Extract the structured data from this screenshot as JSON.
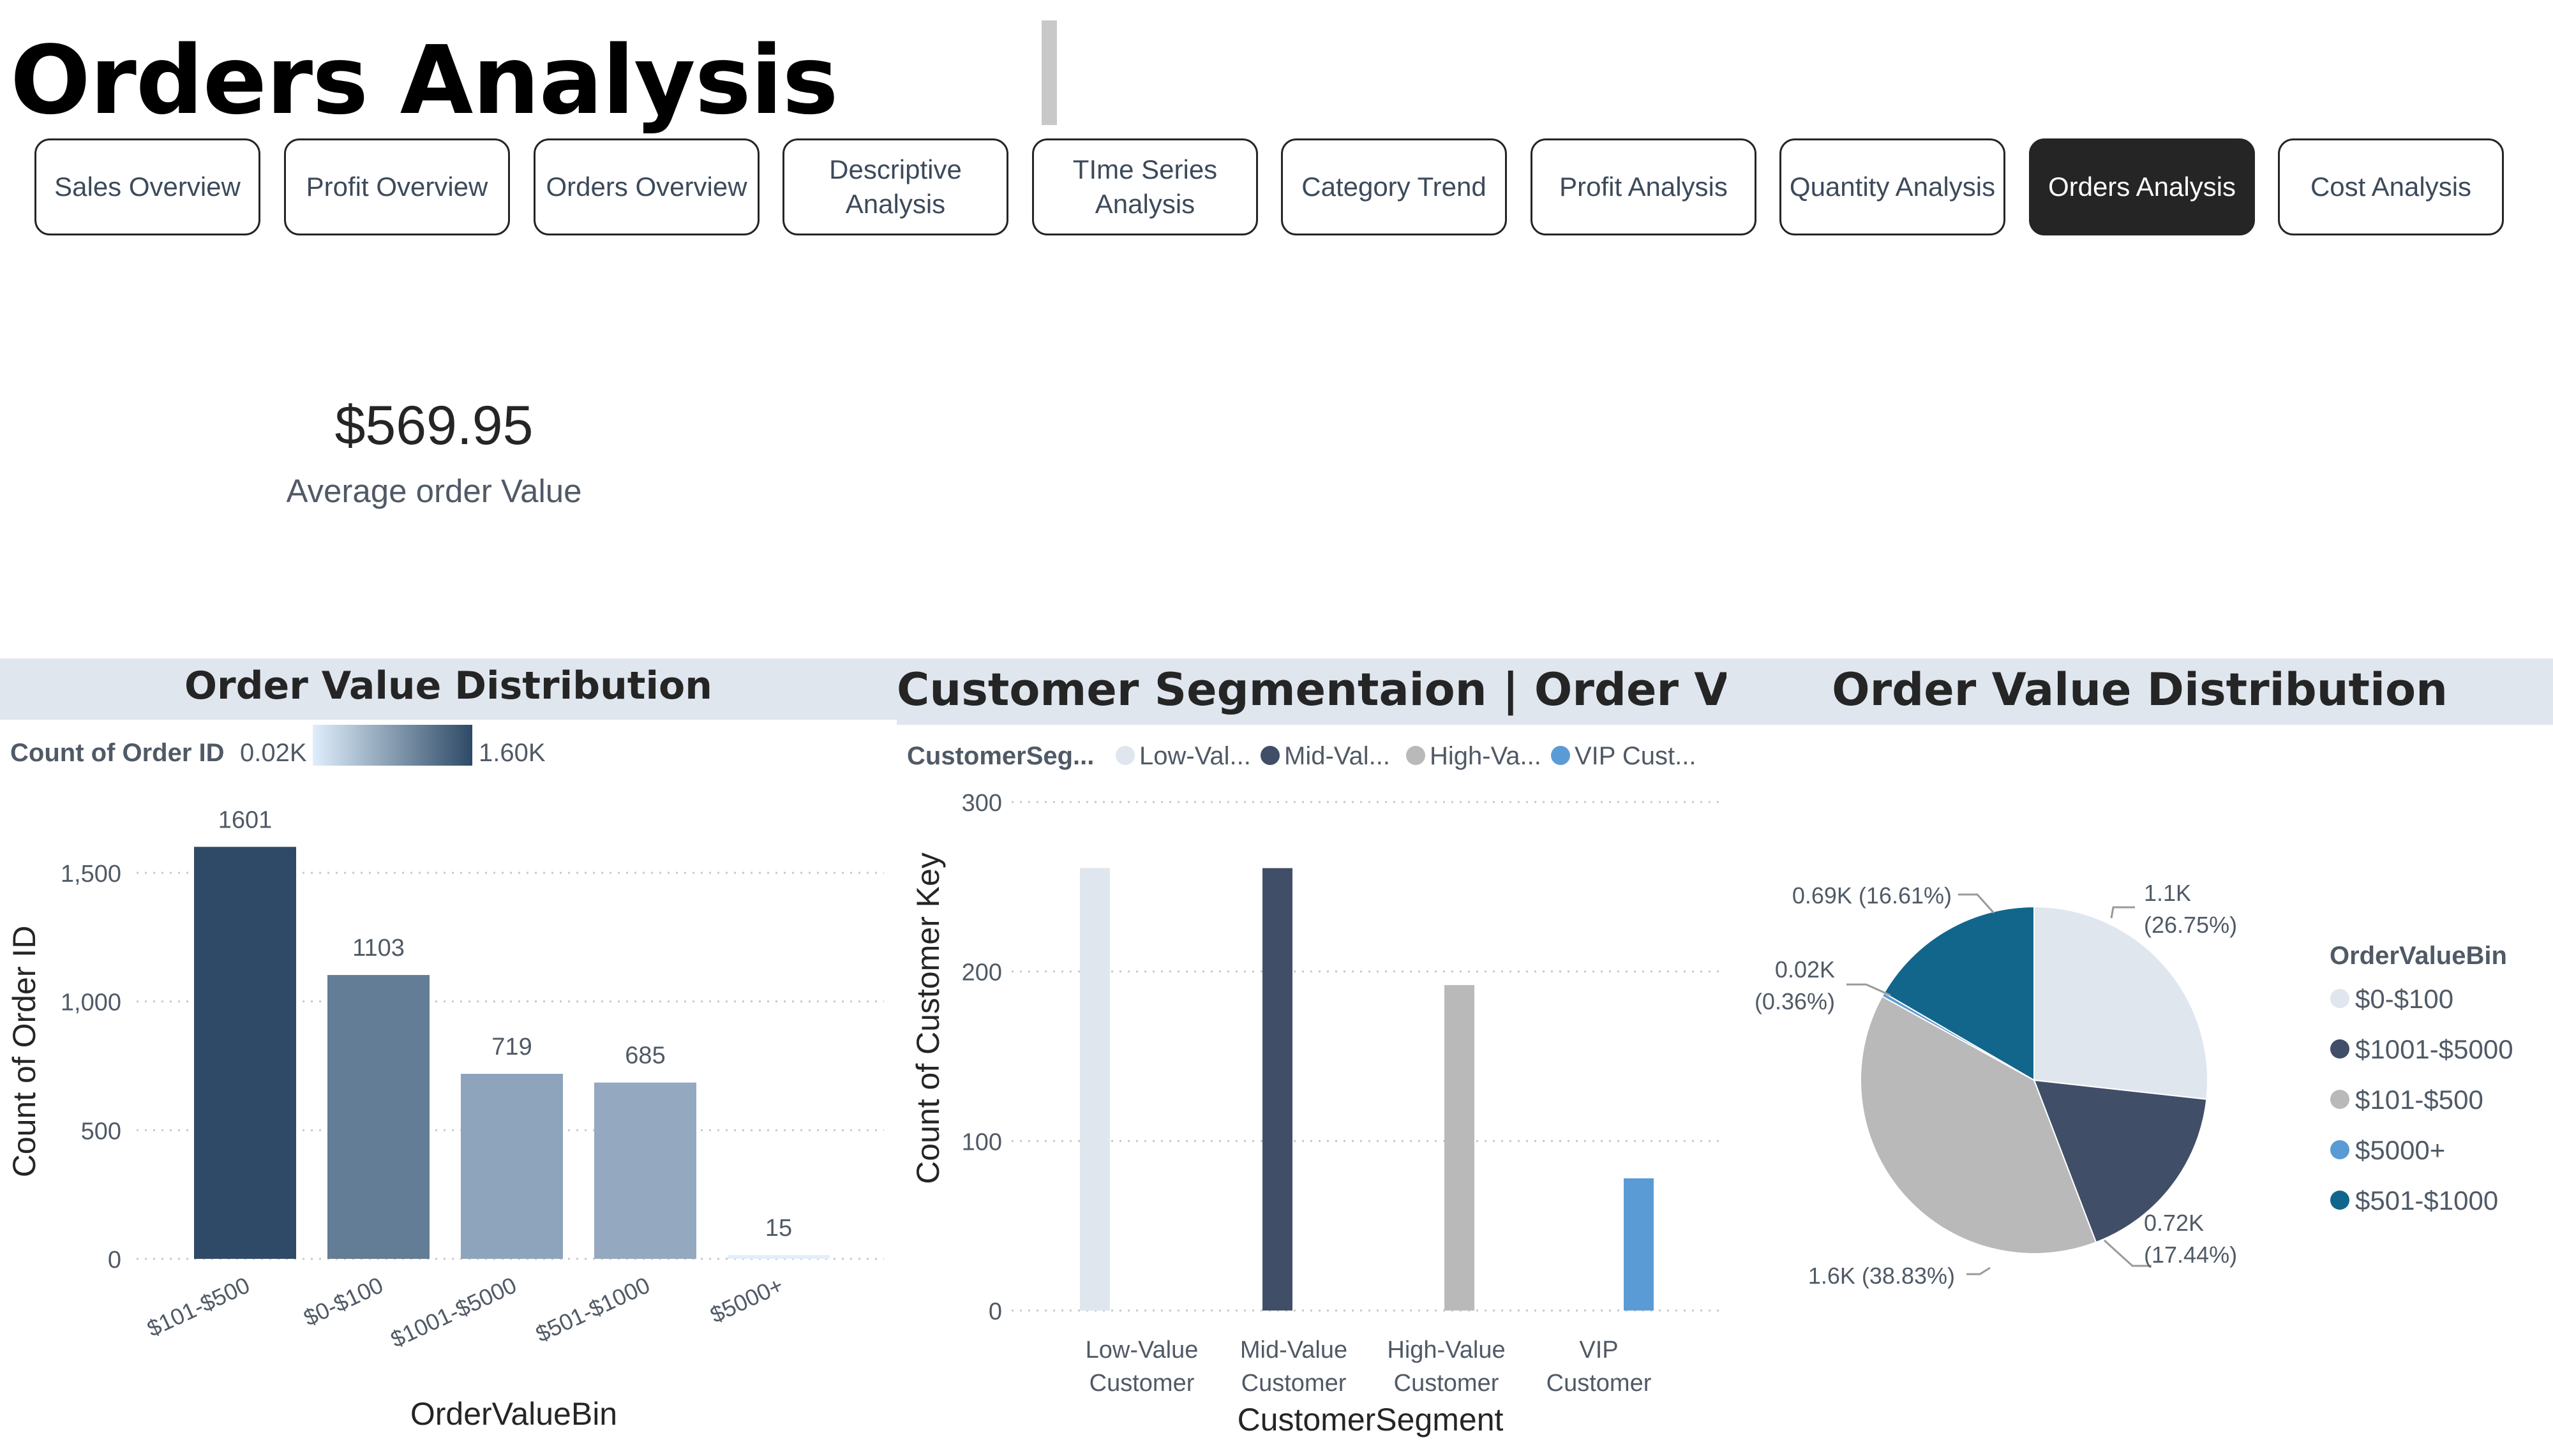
{
  "page": {
    "title": "Orders Analysis"
  },
  "nav": [
    {
      "label": "Sales Overview",
      "active": false
    },
    {
      "label": "Profit Overview",
      "active": false
    },
    {
      "label": "Orders Overview",
      "active": false
    },
    {
      "label": "Descriptive\nAnalysis",
      "active": false
    },
    {
      "label": "TIme Series\nAnalysis",
      "active": false
    },
    {
      "label": "Category Trend",
      "active": false
    },
    {
      "label": "Profit Analysis",
      "active": false
    },
    {
      "label": "Quantity Analysis",
      "active": false
    },
    {
      "label": "Orders Analysis",
      "active": true
    },
    {
      "label": "Cost Analysis",
      "active": false
    }
  ],
  "kpi": {
    "value": "$569.95",
    "label": "Average order Value"
  },
  "colors": {
    "dark": "#252525",
    "band": "#dfe6ee"
  },
  "chart_data": [
    {
      "type": "bar",
      "title": "Order Value Distribution",
      "categories": [
        "$101-$500",
        "$0-$100",
        "$1001-$5000",
        "$501-$1000",
        "$5000+"
      ],
      "values": [
        1601,
        1103,
        719,
        685,
        15
      ],
      "data_labels": [
        "1601",
        "1103",
        "719",
        "685",
        "15"
      ],
      "colors": [
        "#2e4a66",
        "#647d96",
        "#8ea4bc",
        "#94a9c0",
        "#e4eef8"
      ],
      "xlabel": "OrderValueBin",
      "ylabel": "Count of Order ID",
      "ylim": [
        0,
        1700
      ],
      "yticks": [
        0,
        500,
        1000,
        1500
      ],
      "ytick_labels": [
        "0",
        "500",
        "1,000",
        "1,500"
      ],
      "gradient_legend": {
        "label": "Count of Order ID",
        "min": "0.02K",
        "max": "1.60K",
        "from": "#dfeefc",
        "to": "#2e4a66"
      },
      "grid": true
    },
    {
      "type": "bar",
      "title": "Customer Segmentaion | Order Value",
      "legend_title": "CustomerSeg...",
      "legend": [
        {
          "label": "Low-Val...",
          "color": "#dfe6ee"
        },
        {
          "label": "Mid-Val...",
          "color": "#404e68"
        },
        {
          "label": "High-Va...",
          "color": "#b9b9b9"
        },
        {
          "label": "VIP Cust...",
          "color": "#5b9bd5"
        }
      ],
      "categories": [
        "Low-Value\nCustomer",
        "Mid-Value\nCustomer",
        "High-Value\nCustomer",
        "VIP\nCustomer"
      ],
      "values": [
        261,
        261,
        192,
        78
      ],
      "colors": [
        "#dfe6ee",
        "#404e68",
        "#b9b9b9",
        "#5b9bd5"
      ],
      "xlabel": "CustomerSegment",
      "ylabel": "Count of Customer Key",
      "ylim": [
        0,
        300
      ],
      "yticks": [
        0,
        100,
        200,
        300
      ],
      "grid": true
    },
    {
      "type": "pie",
      "title": "Order Value Distribution",
      "legend_title": "OrderValueBin",
      "legend_placement": "right",
      "slices": [
        {
          "label": "$0-$100",
          "value": 26.75,
          "color": "#dfe6ee",
          "data_label": "1.1K\n(26.75%)"
        },
        {
          "label": "$1001-$5000",
          "value": 17.44,
          "color": "#404e68",
          "data_label": "0.72K\n(17.44%)"
        },
        {
          "label": "$101-$500",
          "value": 38.83,
          "color": "#b9b9b9",
          "data_label": "1.6K (38.83%)"
        },
        {
          "label": "$5000+",
          "value": 0.36,
          "color": "#5b9bd5",
          "data_label": "0.02K\n(0.36%)"
        },
        {
          "label": "$501-$1000",
          "value": 16.61,
          "color": "#12668c",
          "data_label": "0.69K (16.61%)"
        }
      ]
    }
  ]
}
